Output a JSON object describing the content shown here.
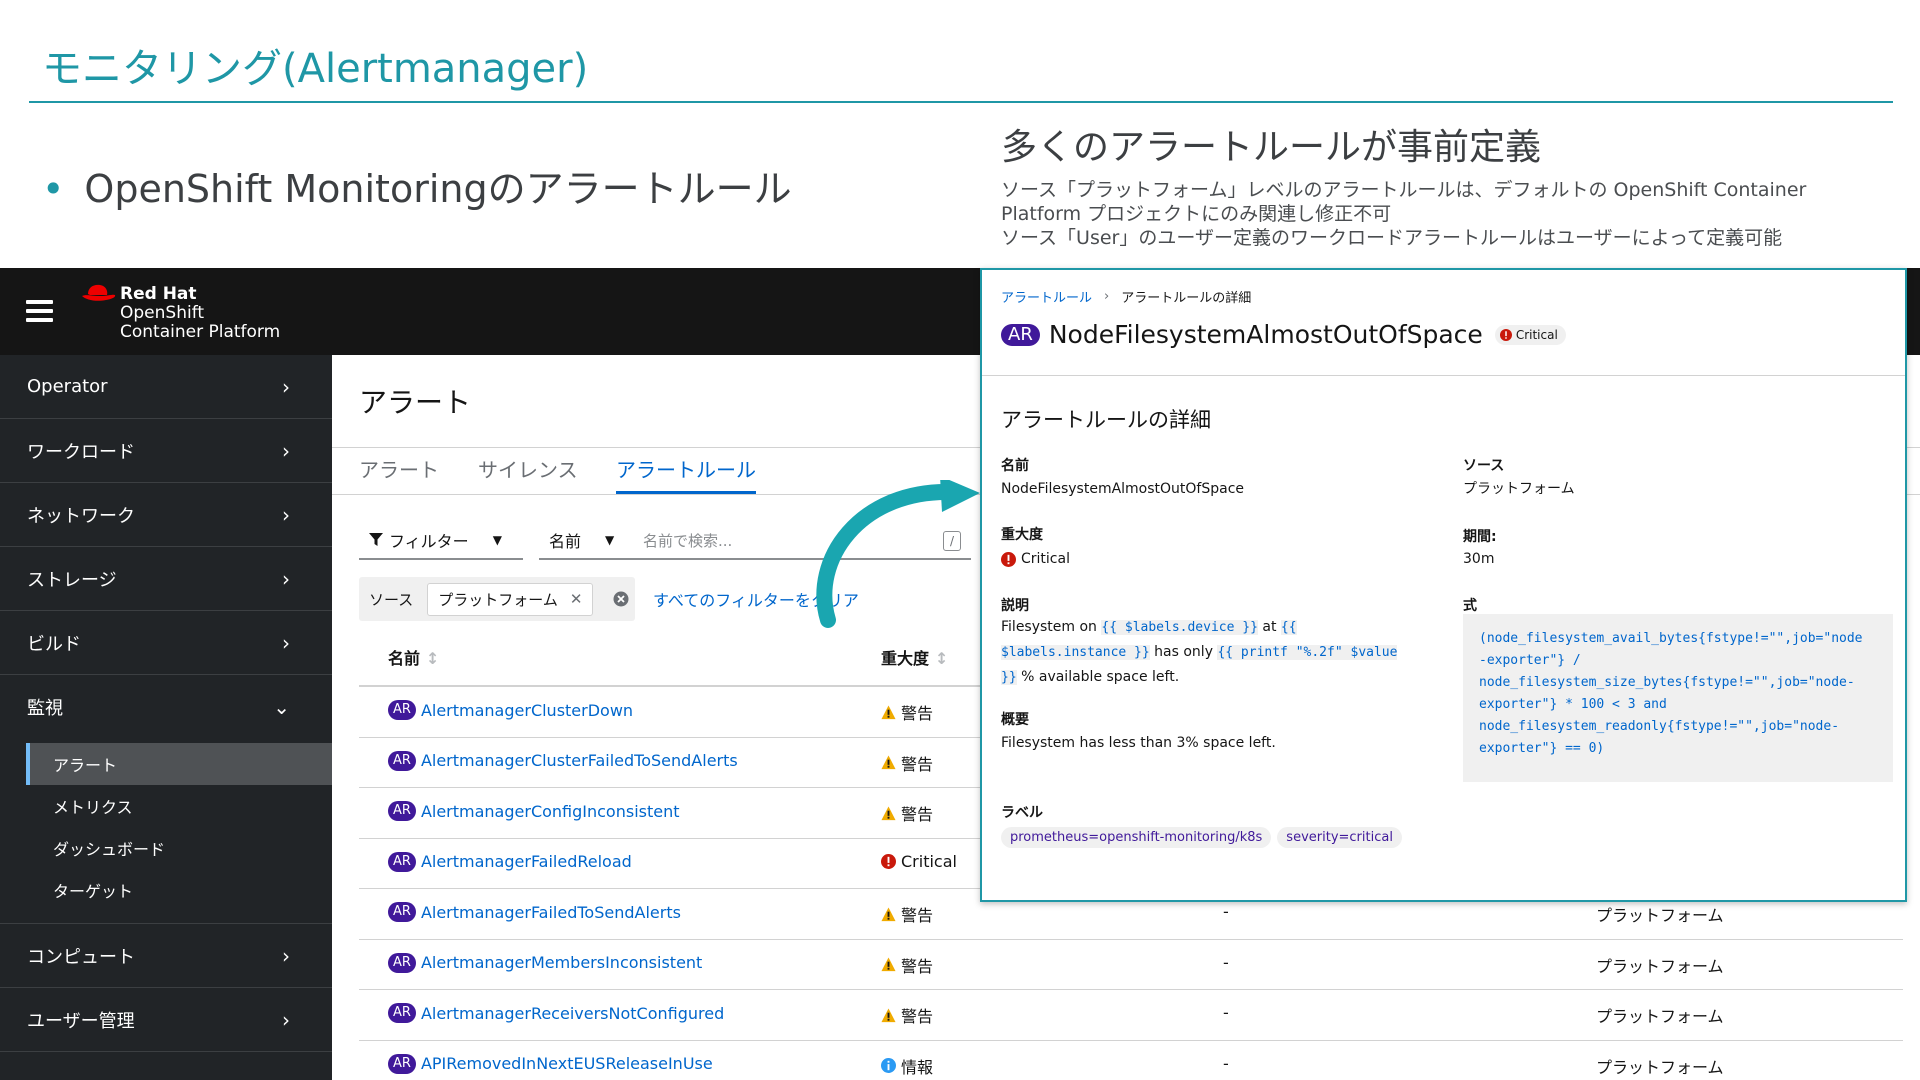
{
  "slide": {
    "title": "モニタリング(Alertmanager)",
    "bullet": "OpenShift Monitoringのアラートルール",
    "callout_heading": "多くのアラートルールが事前定義",
    "callout_lines": [
      "ソース「プラットフォーム」レベルのアラートルールは、デフォルトの OpenShift Container",
      "Platform プロジェクトにのみ関連し修正不可",
      "ソース「User」のユーザー定義のワークロードアラートルールはユーザーによって定義可能"
    ]
  },
  "masthead": {
    "logo_line1": "Red Hat",
    "logo_line2": "OpenShift",
    "logo_line3": "Container Platform"
  },
  "sidebar": {
    "items": [
      {
        "label": "Operator"
      },
      {
        "label": "ワークロード"
      },
      {
        "label": "ネットワーク"
      },
      {
        "label": "ストレージ"
      },
      {
        "label": "ビルド"
      },
      {
        "label": "監視"
      },
      {
        "label": "コンピュート"
      },
      {
        "label": "ユーザー管理"
      }
    ],
    "monitoring_sub": [
      {
        "label": "アラート"
      },
      {
        "label": "メトリクス"
      },
      {
        "label": "ダッシュボード"
      },
      {
        "label": "ターゲット"
      }
    ]
  },
  "main": {
    "page_title": "アラート",
    "tabs": [
      {
        "label": "アラート"
      },
      {
        "label": "サイレンス"
      },
      {
        "label": "アラートルール"
      }
    ],
    "filter_label": "フィルター",
    "name_select": "名前",
    "search_placeholder": "名前で検索...",
    "search_hint_key": "/",
    "chip_category": "ソース",
    "chip_value": "プラットフォーム",
    "clear_all": "すべてのフィルターをクリア",
    "columns": {
      "name": "名前",
      "severity": "重大度"
    },
    "rows": [
      {
        "badge": "AR",
        "name": "AlertmanagerClusterDown",
        "severity": "警告",
        "level": "warning",
        "dash": "",
        "source": ""
      },
      {
        "badge": "AR",
        "name": "AlertmanagerClusterFailedToSendAlerts",
        "severity": "警告",
        "level": "warning",
        "dash": "",
        "source": ""
      },
      {
        "badge": "AR",
        "name": "AlertmanagerConfigInconsistent",
        "severity": "警告",
        "level": "warning",
        "dash": "",
        "source": ""
      },
      {
        "badge": "AR",
        "name": "AlertmanagerFailedReload",
        "severity": "Critical",
        "level": "critical",
        "dash": "",
        "source": ""
      },
      {
        "badge": "AR",
        "name": "AlertmanagerFailedToSendAlerts",
        "severity": "警告",
        "level": "warning",
        "dash": "-",
        "source": "プラットフォーム"
      },
      {
        "badge": "AR",
        "name": "AlertmanagerMembersInconsistent",
        "severity": "警告",
        "level": "warning",
        "dash": "-",
        "source": "プラットフォーム"
      },
      {
        "badge": "AR",
        "name": "AlertmanagerReceiversNotConfigured",
        "severity": "警告",
        "level": "warning",
        "dash": "-",
        "source": "プラットフォーム"
      },
      {
        "badge": "AR",
        "name": "APIRemovedInNextEUSReleaseInUse",
        "severity": "情報",
        "level": "info",
        "dash": "-",
        "source": "プラットフォーム"
      }
    ]
  },
  "panel": {
    "breadcrumb_link": "アラートルール",
    "breadcrumb_current": "アラートルールの詳細",
    "badge": "AR",
    "title": "NodeFilesystemAlmostOutOfSpace",
    "title_severity": "Critical",
    "section_title": "アラートルールの詳細",
    "name_label": "名前",
    "name_value": "NodeFilesystemAlmostOutOfSpace",
    "source_label": "ソース",
    "source_value": "プラットフォーム",
    "severity_label": "重大度",
    "severity_value": "Critical",
    "period_label": "期間:",
    "period_value": "30m",
    "description_label": "説明",
    "desc_text1": "Filesystem on",
    "desc_code1": "{{ $labels.device }}",
    "desc_text2": "at",
    "desc_code2a": "{{",
    "desc_code2b": "$labels.instance }}",
    "desc_text3": "has only",
    "desc_code3a": "{{ printf \"%.2f\" $value",
    "desc_code3b": "}}",
    "desc_text4": "% available space left.",
    "expression_label": "式",
    "expression_lines": [
      "(node_filesystem_avail_bytes{fstype!=\"\",job=\"node",
      "-exporter\"} /",
      "node_filesystem_size_bytes{fstype!=\"\",job=\"node-",
      "exporter\"} * 100 < 3 and",
      "node_filesystem_readonly{fstype!=\"\",job=\"node-",
      "exporter\"} == 0)"
    ],
    "summary_label": "概要",
    "summary_value": "Filesystem has less than 3% space left.",
    "labels_label": "ラベル",
    "labels": [
      "prometheus=openshift-monitoring/k8s",
      "severity=critical"
    ]
  },
  "colors": {
    "accent_teal": "#1f97a6",
    "link_blue": "#0066cc",
    "ar_purple": "#40199a",
    "critical_red": "#c9190b",
    "warning_gold": "#f0ab00",
    "info_blue": "#2b9af3"
  }
}
